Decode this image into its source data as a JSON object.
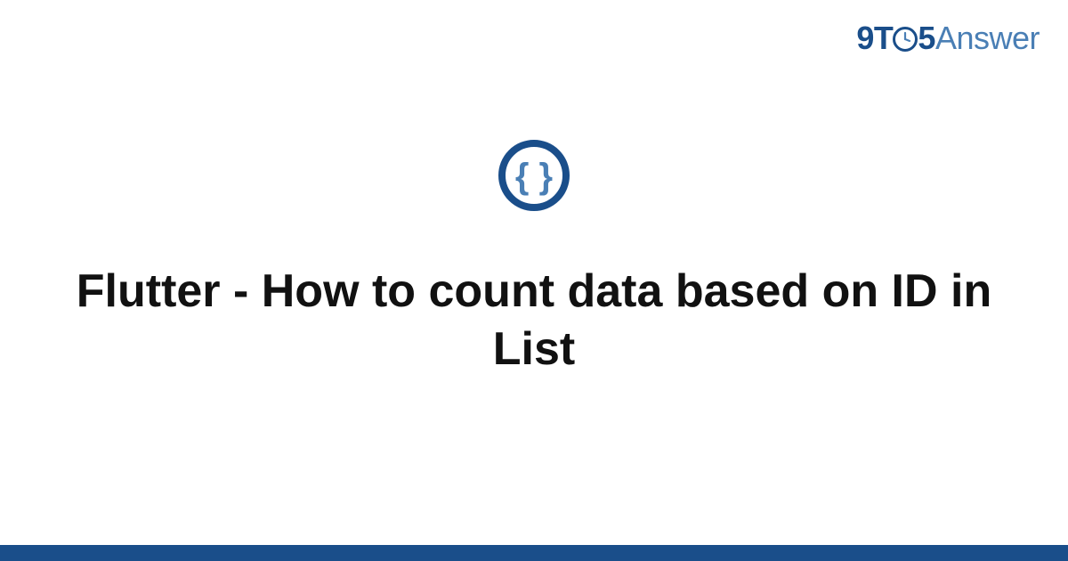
{
  "logo": {
    "part1": "9T",
    "part2": "5",
    "part3": "Answer"
  },
  "icon": {
    "name": "code-braces-icon"
  },
  "title": "Flutter - How to count data based on ID in List",
  "colors": {
    "primary_dark": "#1a4e8a",
    "primary_light": "#4a7fb5",
    "text": "#111111",
    "background": "#ffffff"
  }
}
